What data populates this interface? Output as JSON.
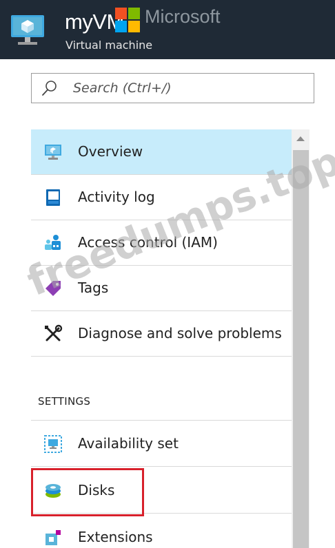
{
  "header": {
    "title": "myVM",
    "subtitle": "Virtual machine",
    "overlay_brand": "Microsoft"
  },
  "search": {
    "placeholder": "Search (Ctrl+/)"
  },
  "menu": {
    "items": [
      {
        "label": "Overview",
        "icon": "monitor-icon",
        "active": true
      },
      {
        "label": "Activity log",
        "icon": "activity-log-icon"
      },
      {
        "label": "Access control (IAM)",
        "icon": "people-icon"
      },
      {
        "label": "Tags",
        "icon": "tag-icon"
      },
      {
        "label": "Diagnose and solve problems",
        "icon": "wrench-screwdriver-icon"
      }
    ]
  },
  "settings": {
    "heading": "SETTINGS",
    "items": [
      {
        "label": "Availability set",
        "icon": "availability-set-icon"
      },
      {
        "label": "Disks",
        "icon": "disks-icon",
        "highlighted": true
      },
      {
        "label": "Extensions",
        "icon": "extensions-icon"
      }
    ]
  },
  "watermark": "freedumps.top",
  "colors": {
    "header_bg": "#1f2a36",
    "active_item_bg": "#c7ecfb",
    "highlight_border": "#d8202b",
    "scroll_thumb": "#c5c5c5"
  }
}
